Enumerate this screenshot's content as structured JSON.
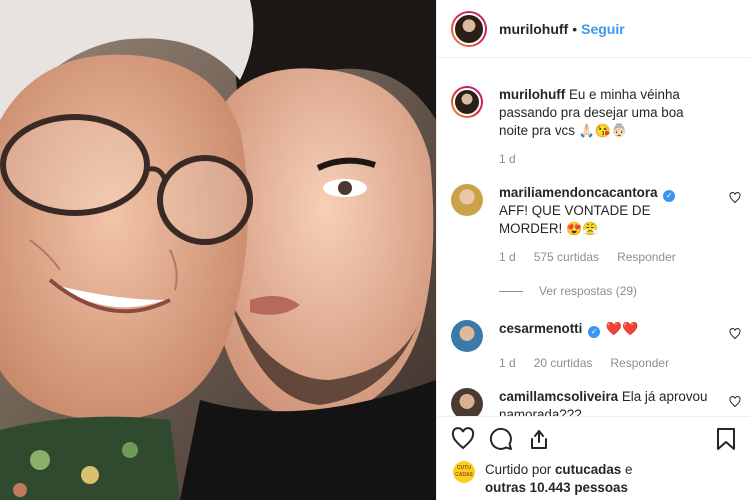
{
  "post": {
    "author": "murilohuff",
    "separator": "•",
    "follow_label": "Seguir"
  },
  "caption": {
    "username": "murilohuff",
    "text": "Eu e minha véinha passando pra desejar uma boa noite pra vcs",
    "emojis": "🙏🏻😘👵🏻",
    "time": "1 d"
  },
  "comments": [
    {
      "username": "mariliamendoncacantora",
      "verified": true,
      "text": "AFF! QUE VONTADE DE MORDER!",
      "emojis": "😍😤",
      "time": "1 d",
      "likes": "575 curtidas",
      "reply_label": "Responder",
      "view_replies": "Ver respostas (29)"
    },
    {
      "username": "cesarmenotti",
      "verified": true,
      "text": "",
      "emojis": "❤️❤️",
      "time": "1 d",
      "likes": "20 curtidas",
      "reply_label": "Responder"
    },
    {
      "username": "camillamcsoliveira",
      "verified": false,
      "text": "Ela já aprovou namorada???",
      "emojis": ""
    }
  ],
  "liked_by": {
    "prefix": "Curtido por",
    "user": "cutucadas",
    "suffix": "e",
    "others": "outras 10.443 pessoas",
    "avatar_text": "CUTU CADAS"
  },
  "icons": [
    "heart-icon",
    "comment-icon",
    "share-icon",
    "bookmark-icon",
    "verified-icon",
    "like-comment-icon"
  ],
  "colors": {
    "accent": "#3897f0",
    "text": "#262626",
    "muted": "#8e8e8e",
    "heart": "#ed4956"
  }
}
